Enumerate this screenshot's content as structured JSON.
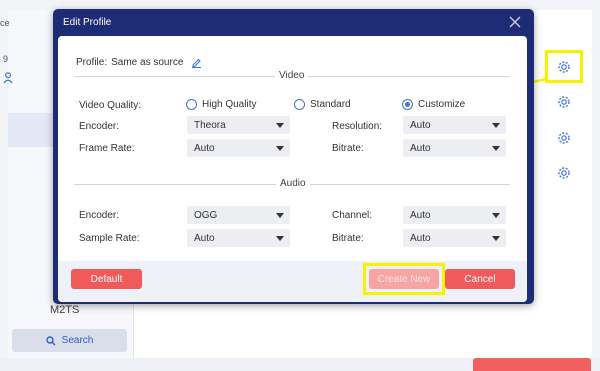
{
  "background": {
    "edge_text_top": "ce",
    "edge_text_num": "9",
    "format_label": "M2TS",
    "search_label": "Search"
  },
  "dialog": {
    "title": "Edit Profile",
    "profile_label": "Profile:",
    "profile_value": "Same as source",
    "video_section": "Video",
    "audio_section": "Audio",
    "video": {
      "quality_label": "Video Quality:",
      "quality_options": [
        "High Quality",
        "Standard",
        "Customize"
      ],
      "quality_selected": "Customize",
      "encoder_label": "Encoder:",
      "encoder_value": "Theora",
      "resolution_label": "Resolution:",
      "resolution_value": "Auto",
      "framerate_label": "Frame Rate:",
      "framerate_value": "Auto",
      "bitrate_label": "Bitrate:",
      "bitrate_value": "Auto"
    },
    "audio": {
      "encoder_label": "Encoder:",
      "encoder_value": "OGG",
      "channel_label": "Channel:",
      "channel_value": "Auto",
      "samplerate_label": "Sample Rate:",
      "samplerate_value": "Auto",
      "bitrate_label": "Bitrate:",
      "bitrate_value": "Auto"
    },
    "buttons": {
      "default": "Default",
      "create_new": "Create New",
      "cancel": "Cancel"
    }
  },
  "colors": {
    "dialog_header": "#1d2c75",
    "accent_red": "#f15a5a",
    "radio_blue": "#3f73d8",
    "highlight_yellow": "#f7f300"
  },
  "icons": [
    "edit-pencil-icon",
    "close-icon",
    "gear-icon",
    "search-icon",
    "user-icon"
  ]
}
